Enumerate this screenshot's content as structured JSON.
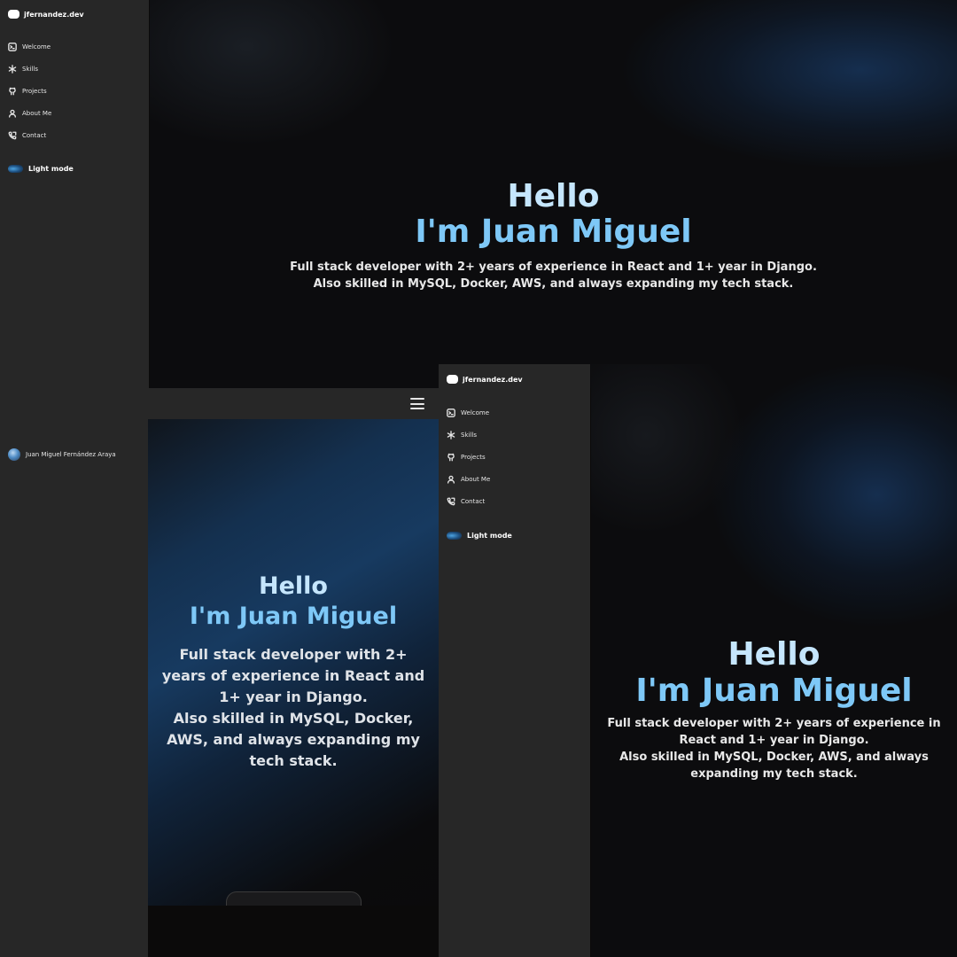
{
  "brand": {
    "name": "jfernandez.dev"
  },
  "nav": [
    {
      "label": "Welcome",
      "icon": "terminal-icon"
    },
    {
      "label": "Skills",
      "icon": "atom-icon"
    },
    {
      "label": "Projects",
      "icon": "github-icon"
    },
    {
      "label": "About Me",
      "icon": "user-icon"
    },
    {
      "label": "Contact",
      "icon": "phone-icon"
    }
  ],
  "mode_toggle": {
    "label": "Light mode",
    "icon": "moon-icon"
  },
  "profile": {
    "name": "Juan Miguel Fernández Araya"
  },
  "hero": {
    "greeting": "Hello",
    "name": "I'm Juan Miguel",
    "description_line1": "Full stack developer with 2+ years of experience in React and 1+ year in Django.",
    "description_line2": "Also skilled in MySQL, Docker, AWS, and always expanding my tech stack."
  },
  "colors": {
    "sidebar_bg": "#272727",
    "page_bg": "#0b0a0a",
    "greeting": "#c5e6fd",
    "name_accent": "#7ec8f7"
  }
}
